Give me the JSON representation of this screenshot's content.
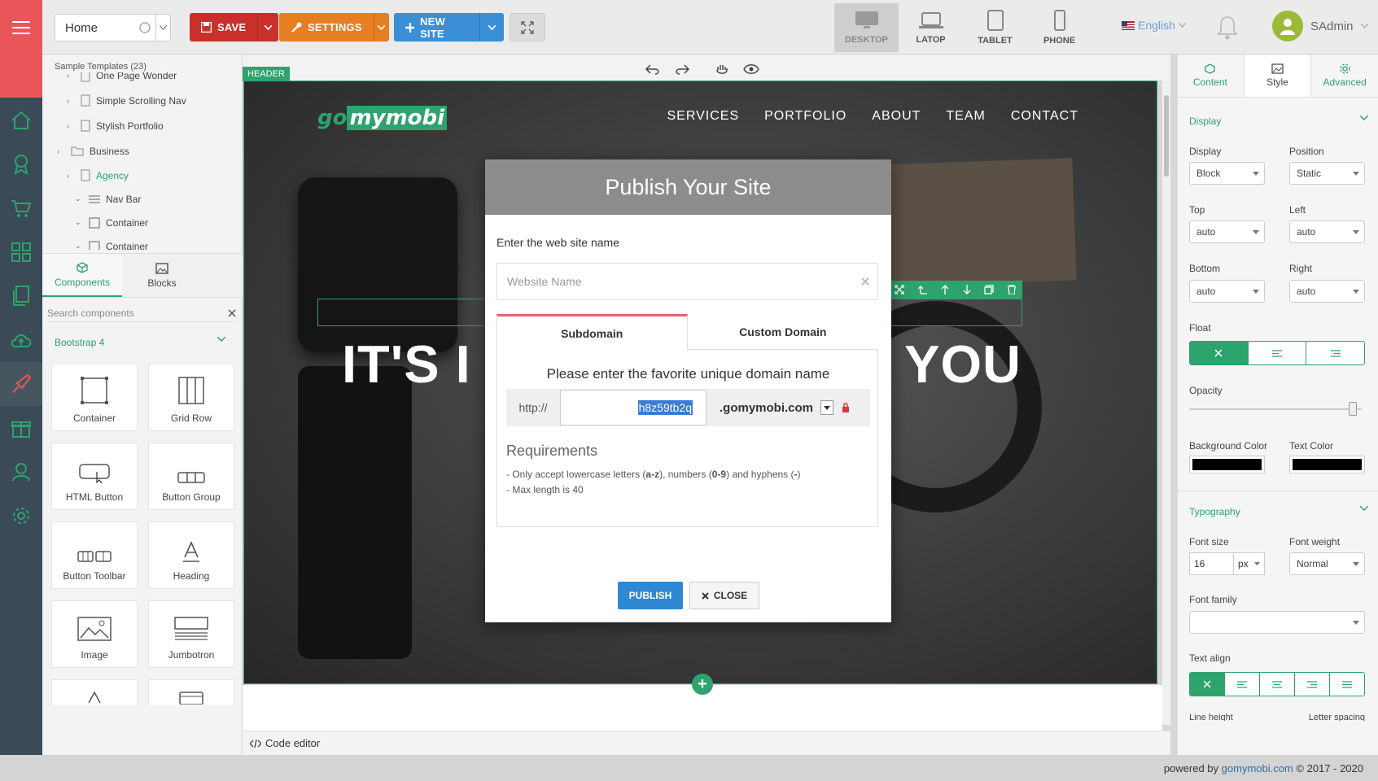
{
  "topbar": {
    "page_select": "Home",
    "save_label": "SAVE",
    "settings_label": "SETTINGS",
    "new_site_label": "NEW SITE",
    "devices": [
      {
        "label": "DESKTOP",
        "icon": "desktop-icon",
        "active": true
      },
      {
        "label": "LATOP",
        "icon": "laptop-icon",
        "active": false
      },
      {
        "label": "TABLET",
        "icon": "tablet-icon",
        "active": false
      },
      {
        "label": "PHONE",
        "icon": "phone-icon",
        "active": false
      }
    ],
    "language": "English",
    "username": "SAdmin"
  },
  "left_panel": {
    "tree_title": "Sample Templates (23)",
    "tree_items": [
      {
        "label": "One Page Wonder",
        "indent": 2,
        "arrow": ">",
        "icon": "page"
      },
      {
        "label": "Simple Scrolling Nav",
        "indent": 2,
        "arrow": ">",
        "icon": "page"
      },
      {
        "label": "Stylish Portfolio",
        "indent": 2,
        "arrow": ">",
        "icon": "page"
      },
      {
        "label": "Business",
        "indent": 1,
        "arrow": ">",
        "icon": "folder"
      },
      {
        "label": "Agency",
        "indent": 2,
        "arrow": ">",
        "icon": "page",
        "active": true
      },
      {
        "label": "Nav Bar",
        "indent": 3,
        "arrow": "v",
        "icon": "navbar"
      },
      {
        "label": "Container",
        "indent": 3,
        "arrow": "v",
        "icon": "container"
      },
      {
        "label": "Container",
        "indent": 3,
        "arrow": "v",
        "icon": "container"
      }
    ],
    "tabs": [
      {
        "label": "Components",
        "icon": "cube-icon",
        "active": true
      },
      {
        "label": "Blocks",
        "icon": "image-icon",
        "active": false
      }
    ],
    "search_placeholder": "Search components",
    "group_title": "Bootstrap 4",
    "components": [
      {
        "label": "Container",
        "icon": "container-icon"
      },
      {
        "label": "Grid Row",
        "icon": "grid-row-icon"
      },
      {
        "label": "HTML Button",
        "icon": "button-icon"
      },
      {
        "label": "Button Group",
        "icon": "button-group-icon"
      },
      {
        "label": "Button Toolbar",
        "icon": "button-toolbar-icon"
      },
      {
        "label": "Heading",
        "icon": "heading-icon"
      },
      {
        "label": "Image",
        "icon": "image-icon"
      },
      {
        "label": "Jumbotron",
        "icon": "jumbotron-icon"
      }
    ]
  },
  "canvas": {
    "section_badge": "HEADER",
    "brand_part1": "go",
    "brand_part2": "mymobi",
    "nav": [
      "SERVICES",
      "PORTFOLIO",
      "ABOUT",
      "TEAM",
      "CONTACT"
    ],
    "hero_left": "IT'S I",
    "hero_right": "T YOU",
    "code_editor_label": "Code editor"
  },
  "modal": {
    "title": "Publish Your Site",
    "name_label": "Enter the web site name",
    "name_placeholder": "Website Name",
    "tab_subdomain": "Subdomain",
    "tab_custom": "Custom Domain",
    "unique_label": "Please enter the favorite unique domain name",
    "prefix": "http://",
    "subdomain_value": "h8z59tb2q",
    "suffix": ".gomymobi.com",
    "req_title": "Requirements",
    "req_line1_a": "- Only accept lowercase letters (",
    "req_line1_b": "a-z",
    "req_line1_c": "), numbers (",
    "req_line1_d": "0-9",
    "req_line1_e": ") and hyphens (",
    "req_line1_f": "-",
    "req_line1_g": ")",
    "req_line2": "- Max length is 40",
    "publish_label": "PUBLISH",
    "close_label": "CLOSE"
  },
  "right_panel": {
    "tabs": [
      "Content",
      "Style",
      "Advanced"
    ],
    "display_section": "Display",
    "display_label": "Display",
    "display_value": "Block",
    "position_label": "Position",
    "position_value": "Static",
    "top_label": "Top",
    "top_value": "auto",
    "left_label": "Left",
    "left_value": "auto",
    "bottom_label": "Bottom",
    "bottom_value": "auto",
    "right_label": "Right",
    "right_value": "auto",
    "float_label": "Float",
    "opacity_label": "Opacity",
    "opacity_value": 1.0,
    "bg_color_label": "Background Color",
    "text_color_label": "Text Color",
    "typography_section": "Typography",
    "font_size_label": "Font size",
    "font_size_value": "16",
    "font_size_unit": "px",
    "font_weight_label": "Font weight",
    "font_weight_value": "Normal",
    "font_family_label": "Font family",
    "text_align_label": "Text align",
    "line_height_label": "Line height",
    "letter_spacing_label": "Letter spacing"
  },
  "footer": {
    "powered_prefix": "powered by ",
    "powered_link": "gomymobi.com",
    "powered_suffix": " © 2017 - 2020"
  },
  "colors": {
    "accent_green": "#2da36e",
    "save_red": "#c9302c",
    "settings_orange": "#e67e22",
    "new_site_blue": "#3a8fd6",
    "rail_dark": "#3a4a56"
  }
}
